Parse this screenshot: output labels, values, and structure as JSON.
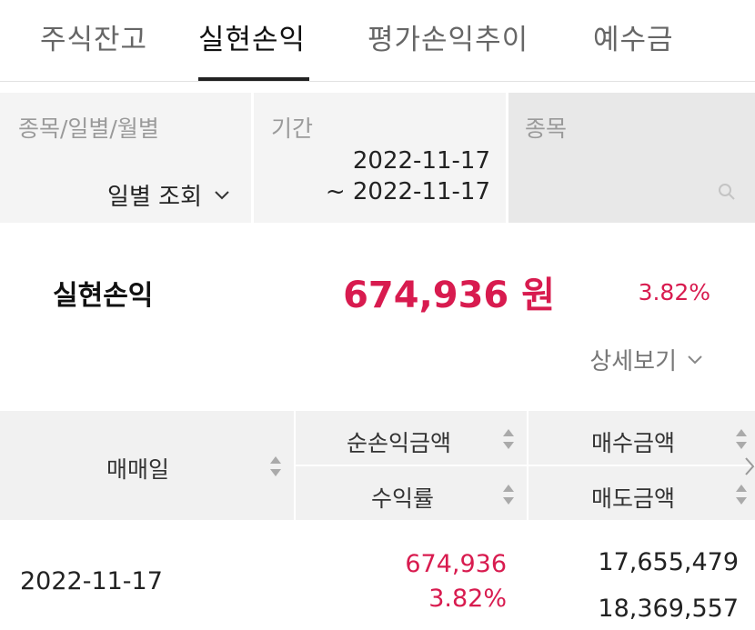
{
  "tabs": [
    {
      "label": "주식잔고",
      "active": false
    },
    {
      "label": "실현손익",
      "active": true
    },
    {
      "label": "평가손익추이",
      "active": false
    },
    {
      "label": "예수금",
      "active": false
    }
  ],
  "filters": {
    "type": {
      "label": "종목/일별/월별",
      "value": "일별 조회"
    },
    "period": {
      "label": "기간",
      "start": "2022-11-17",
      "end": "~ 2022-11-17"
    },
    "stock": {
      "label": "종목",
      "value": ""
    }
  },
  "summary": {
    "title": "실현손익",
    "amount": "674,936 원",
    "rate": "3.82%",
    "detail_label": "상세보기"
  },
  "table": {
    "headers": {
      "date": "매매일",
      "net_profit": "순손익금액",
      "profit_rate": "수익률",
      "buy_amount": "매수금액",
      "sell_amount": "매도금액"
    },
    "rows": [
      {
        "date": "2022-11-17",
        "net_profit": "674,936",
        "profit_rate": "3.82%",
        "buy_amount": "17,655,479",
        "sell_amount": "18,369,557"
      }
    ]
  },
  "colors": {
    "accent_red": "#d81b4f",
    "tab_underline": "#222222",
    "filter_bg": "#f4f4f4",
    "table_header_bg": "#f1f1f1"
  },
  "icons": [
    "chevron-down-icon",
    "search-icon",
    "sort-icon",
    "chevron-right-icon"
  ]
}
